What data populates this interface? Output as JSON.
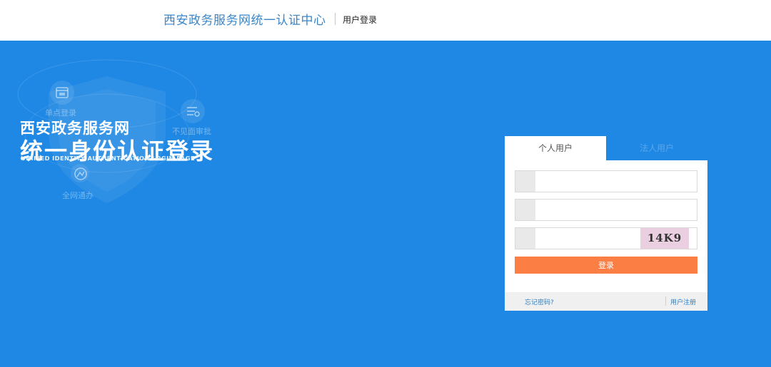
{
  "header": {
    "site_title": "西安政务服务网统一认证中心",
    "sub_title": "用户登录"
  },
  "hero": {
    "line1": "西安政务服务网",
    "line2": "统一身份认证登录",
    "line3": "UNIFIED IDENTITY AUTHENTICATION LOGIN PAGE",
    "features": [
      {
        "label": "单点登录",
        "icon": "calendar-icon"
      },
      {
        "label": "不见面审批",
        "icon": "list-icon"
      },
      {
        "label": "全网通办",
        "icon": "globe-icon"
      }
    ]
  },
  "login": {
    "tabs": [
      {
        "label": "个人用户",
        "active": true
      },
      {
        "label": "法人用户",
        "active": false
      }
    ],
    "username_placeholder": "",
    "password_placeholder": "",
    "captcha_placeholder": "",
    "captcha_code": "14K9",
    "submit_label": "登录",
    "forgot_label": "忘记密码?",
    "register_label": "用户注册"
  },
  "colors": {
    "hero_bg": "#1f88e4",
    "title": "#3a86c8",
    "submit": "#fb7f45",
    "link": "#2a7fc7"
  }
}
